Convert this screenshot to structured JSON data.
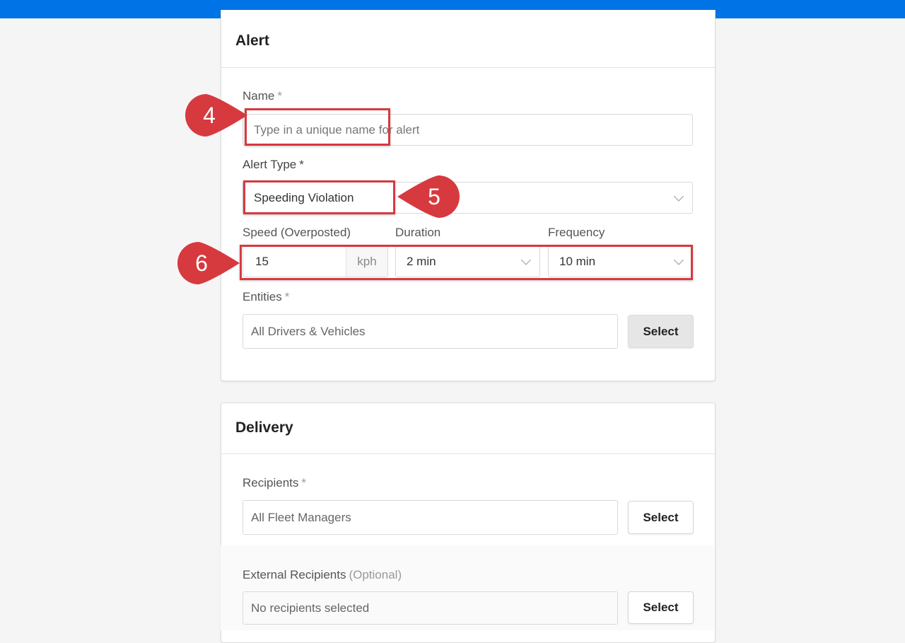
{
  "alert": {
    "title": "Alert",
    "name": {
      "label": "Name",
      "required": "*",
      "placeholder": "Type in a unique name for alert"
    },
    "alert_type": {
      "label": "Alert Type",
      "required": "*",
      "value": "Speeding Violation"
    },
    "speed": {
      "label": "Speed (Overposted)",
      "value": "15",
      "unit": "kph"
    },
    "duration": {
      "label": "Duration",
      "value": "2 min"
    },
    "frequency": {
      "label": "Frequency",
      "value": "10 min"
    },
    "entities": {
      "label": "Entities",
      "required": "*",
      "value": "All Drivers & Vehicles",
      "button": "Select"
    }
  },
  "delivery": {
    "title": "Delivery",
    "recipients": {
      "label": "Recipients",
      "required": "*",
      "value": "All Fleet Managers",
      "button": "Select"
    },
    "external_recipients": {
      "label": "External Recipients",
      "optional": "(Optional)",
      "value": "No recipients selected",
      "button": "Select"
    }
  },
  "callouts": [
    {
      "number": "4"
    },
    {
      "number": "5"
    },
    {
      "number": "6"
    }
  ],
  "colors": {
    "topbar": "#0073e6",
    "callout": "#d63a3f",
    "background": "#f5f5f5"
  }
}
